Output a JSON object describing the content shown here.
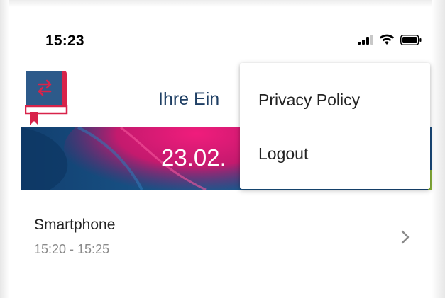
{
  "status_bar": {
    "time": "15:23",
    "icons": [
      "signal-icon",
      "wifi-icon",
      "battery-icon"
    ]
  },
  "header": {
    "title": "Ihre Ein",
    "logo_icon": "book-swap-icon"
  },
  "banner": {
    "date": "23.02."
  },
  "list": {
    "items": [
      {
        "title": "Smartphone",
        "subtitle": "15:20 - 15:25",
        "icon": "chevron-right-icon"
      }
    ]
  },
  "menu": {
    "items": [
      {
        "label": "Privacy Policy"
      },
      {
        "label": "Logout"
      }
    ]
  },
  "colors": {
    "logo_red": "#d8234a",
    "logo_blue": "#2d5a8a",
    "title_blue": "#1f3f64",
    "banner_blue": "#164a7c",
    "banner_pink": "#e6197a"
  }
}
